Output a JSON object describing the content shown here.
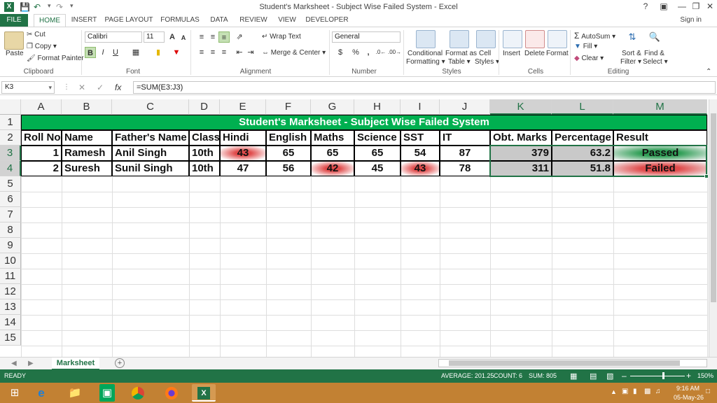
{
  "window": {
    "title": "Student's Marksheet - Subject Wise Failed System - Excel",
    "help": "?",
    "signin": "Sign in"
  },
  "tabs": [
    "FILE",
    "HOME",
    "INSERT",
    "PAGE LAYOUT",
    "FORMULAS",
    "DATA",
    "REVIEW",
    "VIEW",
    "DEVELOPER"
  ],
  "ribbon": {
    "clipboard": {
      "paste": "Paste",
      "cut": "Cut",
      "copy": "Copy",
      "format_painter": "Format Painter",
      "label": "Clipboard"
    },
    "font": {
      "name": "Calibri",
      "size": "11",
      "bold": "B",
      "italic": "I",
      "underline": "U",
      "grow": "A",
      "shrink": "A",
      "label": "Font"
    },
    "alignment": {
      "wrap": "Wrap Text",
      "merge": "Merge & Center",
      "label": "Alignment"
    },
    "number": {
      "format": "General",
      "currency": "$",
      "percent": "%",
      "comma": ",",
      "label": "Number"
    },
    "styles": {
      "conditional": "Conditional",
      "conditional2": "Formatting",
      "format_as": "Format as",
      "format_as2": "Table",
      "cell": "Cell",
      "cell2": "Styles",
      "label": "Styles"
    },
    "cells": {
      "insert": "Insert",
      "delete": "Delete",
      "format": "Format",
      "label": "Cells"
    },
    "editing": {
      "autosum": "AutoSum",
      "fill": "Fill",
      "clear": "Clear",
      "sort": "Sort &",
      "sort2": "Filter",
      "find": "Find &",
      "find2": "Select",
      "label": "Editing"
    }
  },
  "formula_bar": {
    "name_box": "K3",
    "fx": "fx",
    "formula": "=SUM(E3:J3)"
  },
  "columns": [
    "A",
    "B",
    "C",
    "D",
    "E",
    "F",
    "G",
    "H",
    "I",
    "J",
    "K",
    "L",
    "M"
  ],
  "rows": [
    "1",
    "2",
    "3",
    "4",
    "5",
    "6",
    "7",
    "8",
    "9",
    "10",
    "11",
    "12",
    "13",
    "14",
    "15"
  ],
  "sheet": {
    "title": "Student's Marksheet - Subject Wise Failed System",
    "headers": [
      "Roll No",
      "Name",
      "Father's Name",
      "Class",
      "Hindi",
      "English",
      "Maths",
      "Science",
      "SST",
      "IT",
      "Obt. Marks",
      "Percentage",
      "Result"
    ],
    "records": [
      [
        "1",
        "Ramesh",
        "Anil Singh",
        "10th",
        "43",
        "65",
        "65",
        "65",
        "54",
        "87",
        "379",
        "63.2",
        "Passed"
      ],
      [
        "2",
        "Suresh",
        "Sunil Singh",
        "10th",
        "47",
        "56",
        "42",
        "45",
        "43",
        "78",
        "311",
        "51.8",
        "Failed"
      ]
    ]
  },
  "sheet_tabs": {
    "active": "Marksheet",
    "add": "+"
  },
  "status": {
    "ready": "READY",
    "average": "AVERAGE: 201.25",
    "count": "COUNT: 6",
    "sum": "SUM: 805",
    "zoom": "150%"
  },
  "taskbar": {
    "time": "9:16 AM",
    "date": "05-May-26"
  },
  "colors": {
    "excel_green": "#217346",
    "title_fill": "#00b050",
    "pass_fill": "#2e9e55",
    "fail_fill": "#e04b4b",
    "taskbar": "#c28133"
  }
}
